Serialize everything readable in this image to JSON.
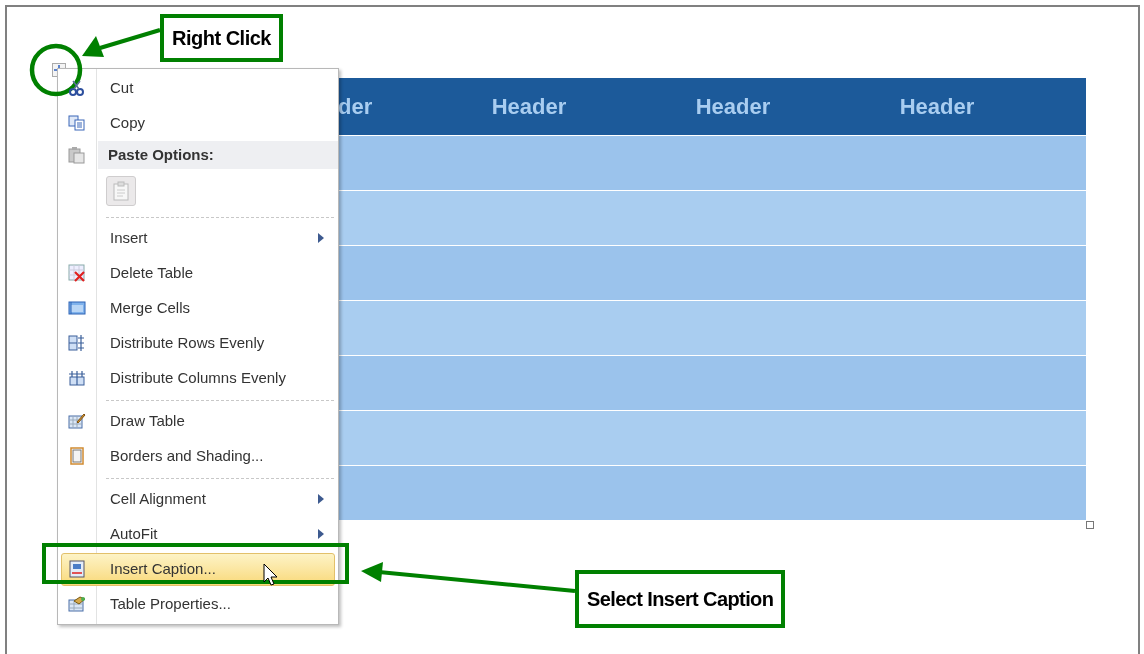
{
  "table": {
    "headers": [
      "der",
      "Header",
      "Header",
      "Header"
    ],
    "rows": [
      {
        "color": "#9bc3ec"
      },
      {
        "color": "#a9cdf0"
      },
      {
        "color": "#9bc3ec"
      },
      {
        "color": "#a9cdf0"
      },
      {
        "color": "#9bc3ec"
      },
      {
        "color": "#a9cdf0"
      },
      {
        "color": "#9bc3ec"
      }
    ]
  },
  "context_menu": {
    "items": [
      {
        "kind": "command",
        "label": "Cut",
        "submenu": false,
        "selected": false
      },
      {
        "kind": "command",
        "label": "Copy",
        "submenu": false,
        "selected": false
      },
      {
        "kind": "header",
        "label": "Paste Options:"
      },
      {
        "kind": "paste"
      },
      {
        "kind": "separator"
      },
      {
        "kind": "command",
        "label": "Insert",
        "submenu": true,
        "selected": false
      },
      {
        "kind": "command",
        "label": "Delete Table",
        "submenu": false,
        "selected": false
      },
      {
        "kind": "command",
        "label": "Merge Cells",
        "submenu": false,
        "selected": false
      },
      {
        "kind": "command",
        "label": "Distribute Rows Evenly",
        "submenu": false,
        "selected": false
      },
      {
        "kind": "command",
        "label": "Distribute Columns Evenly",
        "submenu": false,
        "selected": false
      },
      {
        "kind": "separator"
      },
      {
        "kind": "command",
        "label": "Draw Table",
        "submenu": false,
        "selected": false
      },
      {
        "kind": "command",
        "label": "Borders and Shading...",
        "submenu": false,
        "selected": false
      },
      {
        "kind": "separator"
      },
      {
        "kind": "command",
        "label": "Cell Alignment",
        "submenu": true,
        "selected": false
      },
      {
        "kind": "command",
        "label": "AutoFit",
        "submenu": true,
        "selected": false
      },
      {
        "kind": "command",
        "label": "Insert Caption...",
        "submenu": false,
        "selected": true
      },
      {
        "kind": "command",
        "label": "Table Properties...",
        "submenu": false,
        "selected": false
      }
    ]
  },
  "callouts": [
    {
      "label": "Right Click"
    },
    {
      "label": "Select Insert Caption"
    }
  ]
}
